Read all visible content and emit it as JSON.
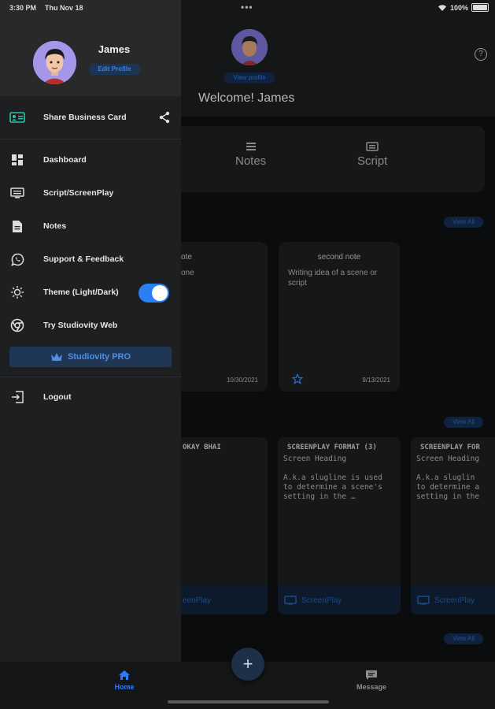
{
  "status_bar": {
    "time": "3:30 PM",
    "date": "Thu Nov 18",
    "battery": "100%"
  },
  "header": {
    "view_profile": "View profile",
    "welcome": "Welcome! James"
  },
  "tabs": [
    {
      "label": "Notes",
      "icon": "notes-icon"
    },
    {
      "label": "Script",
      "icon": "script-icon"
    }
  ],
  "sections": {
    "view_all": "View All"
  },
  "notes": [
    {
      "title": "ote",
      "body": "one",
      "date": "10/30/2021"
    },
    {
      "title": "second note",
      "body_line1": "Writing idea of a scene or",
      "body_line2": "script",
      "date": "9/13/2021"
    }
  ],
  "scripts": [
    {
      "title": "OKAY BHAI",
      "footer": "eenPlay"
    },
    {
      "title": "SCREENPLAY FORMAT (3)",
      "heading": "Screen Heading",
      "line1": "A.k.a slugline is used",
      "line2": "to determine a scene's",
      "line3": "setting in the …",
      "footer": "ScreenPlay"
    },
    {
      "title": "SCREENPLAY FOR",
      "heading": "Screen Heading",
      "line1": "A.k.a sluglin",
      "line2": "to determine a",
      "line3": "setting in the",
      "footer": "ScreenPlay"
    }
  ],
  "bottom_nav": {
    "home": "Home",
    "message": "Message",
    "fab": "+"
  },
  "drawer": {
    "name": "James",
    "edit_profile": "Edit Profile",
    "share": "Share Business Card",
    "items": [
      {
        "label": "Dashboard",
        "icon": "dashboard-icon"
      },
      {
        "label": "Script/ScreenPlay",
        "icon": "keyboard-icon"
      },
      {
        "label": "Notes",
        "icon": "document-icon"
      },
      {
        "label": "Support & Feedback",
        "icon": "whatsapp-icon"
      },
      {
        "label": "Theme (Light/Dark)",
        "icon": "sun-icon"
      },
      {
        "label": "Try Studiovity Web",
        "icon": "chrome-icon"
      }
    ],
    "theme_on": true,
    "pro": "Studiovity PRO",
    "logout": "Logout"
  },
  "colors": {
    "accent": "#2a7ff3",
    "drawer_bg": "#1d1f21",
    "pro_bg": "#1f3654"
  }
}
